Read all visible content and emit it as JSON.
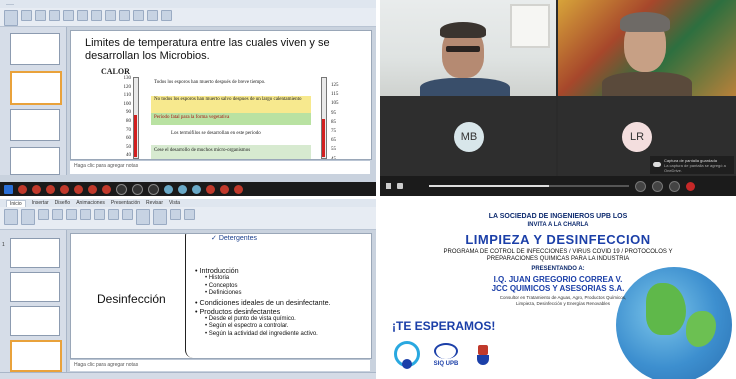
{
  "q1": {
    "slide_title": "Limites de temperatura entre las cuales viven y se desarrollan los Microbios.",
    "calor_label": "CALOR",
    "left_scale": [
      "130",
      "120",
      "110",
      "100",
      "90",
      "80",
      "70",
      "60",
      "50",
      "40"
    ],
    "right_scale": [
      "125",
      "115",
      "105",
      "95",
      "85",
      "75",
      "65",
      "55",
      "45"
    ],
    "bands": [
      {
        "text": "Todos los esporos han muerto después de breve tiempo.",
        "color": "#ffffff"
      },
      {
        "text": "No todos los esporos han muerto salvo despues de un largo calentamiento",
        "color": "#f7e98e"
      },
      {
        "text": "Período fatal para la forma vegetativa",
        "color": "#b9e2a2"
      },
      {
        "text": "Los termófilos se desarrollan en este periodo",
        "color": "#ffffff"
      },
      {
        "text": "Cese el desarrollo de muchos micro-organismos",
        "color": "#d7ead0"
      }
    ],
    "notes_placeholder": "Haga clic para agregar notas"
  },
  "q2": {
    "participant_mb": "MB",
    "participant_lr": "LR",
    "notification_title": "Captura de pantalla guardada",
    "notification_sub": "La captura de pantalla se agregó a OneDrive."
  },
  "q3": {
    "prev_item": "Detergentes",
    "section_title": "Desinfección",
    "items": [
      {
        "level": 1,
        "text": "Introducción"
      },
      {
        "level": 2,
        "text": "Historia"
      },
      {
        "level": 2,
        "text": "Conceptos"
      },
      {
        "level": 2,
        "text": "Definiciones"
      },
      {
        "level": 1,
        "text": "Condiciones ideales de un desinfectante."
      },
      {
        "level": 1,
        "text": "Productos desinfectantes"
      },
      {
        "level": 2,
        "text": "Desde el punto de vista químico."
      },
      {
        "level": 2,
        "text": "Según el espectro a controlar."
      },
      {
        "level": 2,
        "text": "Según la actividad del ingrediente activo."
      }
    ],
    "notes_placeholder": "Haga clic para agregar notas",
    "ribbon_tabs": [
      "Inicio",
      "Insertar",
      "Diseño",
      "Animaciones",
      "Presentación",
      "Revisar",
      "Vista"
    ]
  },
  "q4": {
    "header_line1": "LA SOCIEDAD DE INGENIEROS UPB LOS",
    "header_line2": "INVITA A LA CHARLA",
    "title": "LIMPIEZA Y DESINFECCION",
    "subtitle1": "PROGRAMA DE COTROL DE INFECCIONES / VIRUS COVID 19 / PROTOCOLOS Y",
    "subtitle2": "PREPARACIONES QUIMICAS PARA LA INDUSTRIA",
    "presenting": "PRESENTANDO A:",
    "speaker": "I.Q. JUAN GREGORIO CORREA V.",
    "company": "JCC QUIMICOS Y ASESORIAS S.A.",
    "bio": "Consultor en Tratamiento de Aguas, Agro, Productos Químicos, Limpieza, Desinfección y Energías Renovables",
    "cta": "¡TE ESPERAMOS!",
    "logo_siq": "SIQ UPB",
    "brand_blue": "#1b3fa8",
    "cyan": "#29a8e0"
  }
}
